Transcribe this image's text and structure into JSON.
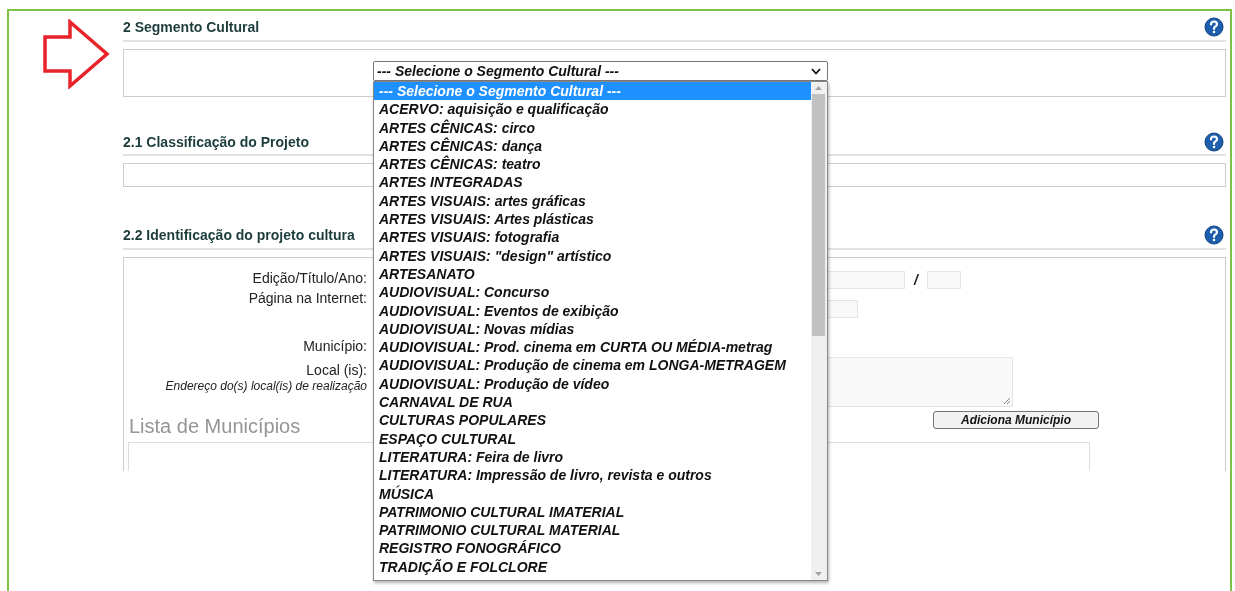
{
  "segment_section": {
    "title": "2 Segmento Cultural",
    "select": {
      "value": "--- Selecione o Segmento Cultural ---",
      "expanded": true,
      "options": [
        {
          "label": "--- Selecione o Segmento Cultural ---",
          "selected": true
        },
        {
          "label": "ACERVO: aquisição e qualificação",
          "selected": false
        },
        {
          "label": "ARTES CÊNICAS: circo",
          "selected": false
        },
        {
          "label": "ARTES CÊNICAS: dança",
          "selected": false
        },
        {
          "label": "ARTES CÊNICAS: teatro",
          "selected": false
        },
        {
          "label": "ARTES INTEGRADAS",
          "selected": false
        },
        {
          "label": "ARTES VISUAIS: artes gráficas",
          "selected": false
        },
        {
          "label": "ARTES VISUAIS: Artes plásticas",
          "selected": false
        },
        {
          "label": "ARTES VISUAIS: fotografia",
          "selected": false
        },
        {
          "label": "ARTES VISUAIS: \"design\" artístico",
          "selected": false
        },
        {
          "label": "ARTESANATO",
          "selected": false
        },
        {
          "label": "AUDIOVISUAL: Concurso",
          "selected": false
        },
        {
          "label": "AUDIOVISUAL: Eventos de exibição",
          "selected": false
        },
        {
          "label": "AUDIOVISUAL: Novas mídias",
          "selected": false
        },
        {
          "label": "AUDIOVISUAL: Prod. cinema em CURTA OU MÉDIA-metrag",
          "selected": false
        },
        {
          "label": "AUDIOVISUAL: Produção de cinema em LONGA-METRAGEM",
          "selected": false
        },
        {
          "label": "AUDIOVISUAL: Produção de vídeo",
          "selected": false
        },
        {
          "label": "CARNAVAL DE RUA",
          "selected": false
        },
        {
          "label": "CULTURAS POPULARES",
          "selected": false
        },
        {
          "label": "ESPAÇO CULTURAL",
          "selected": false
        },
        {
          "label": "LITERATURA: Feira de livro",
          "selected": false
        },
        {
          "label": "LITERATURA: Impressão de livro, revista e outros",
          "selected": false
        },
        {
          "label": "MÚSICA",
          "selected": false
        },
        {
          "label": "PATRIMONIO CULTURAL IMATERIAL",
          "selected": false
        },
        {
          "label": "PATRIMONIO CULTURAL MATERIAL",
          "selected": false
        },
        {
          "label": "REGISTRO FONOGRÁFICO",
          "selected": false
        },
        {
          "label": "TRADIÇÃO E FOLCLORE",
          "selected": false
        }
      ]
    }
  },
  "classification_section": {
    "title": "2.1 Classificação do Projeto"
  },
  "identification_section": {
    "title": "2.2 Identificação do projeto cultura",
    "fields": [
      {
        "kind": "title-year",
        "label": "Edição/Título/Ano:",
        "separator": "/"
      },
      {
        "kind": "url",
        "label": "Página na Internet:"
      },
      {
        "kind": "municipality",
        "label": "Município:"
      },
      {
        "kind": "places",
        "label": "Local (is):",
        "hint": "Endereço do(s) local(is) de realização"
      }
    ],
    "add_button": "Adiciona Município",
    "list_title": "Lista de Municípios"
  }
}
